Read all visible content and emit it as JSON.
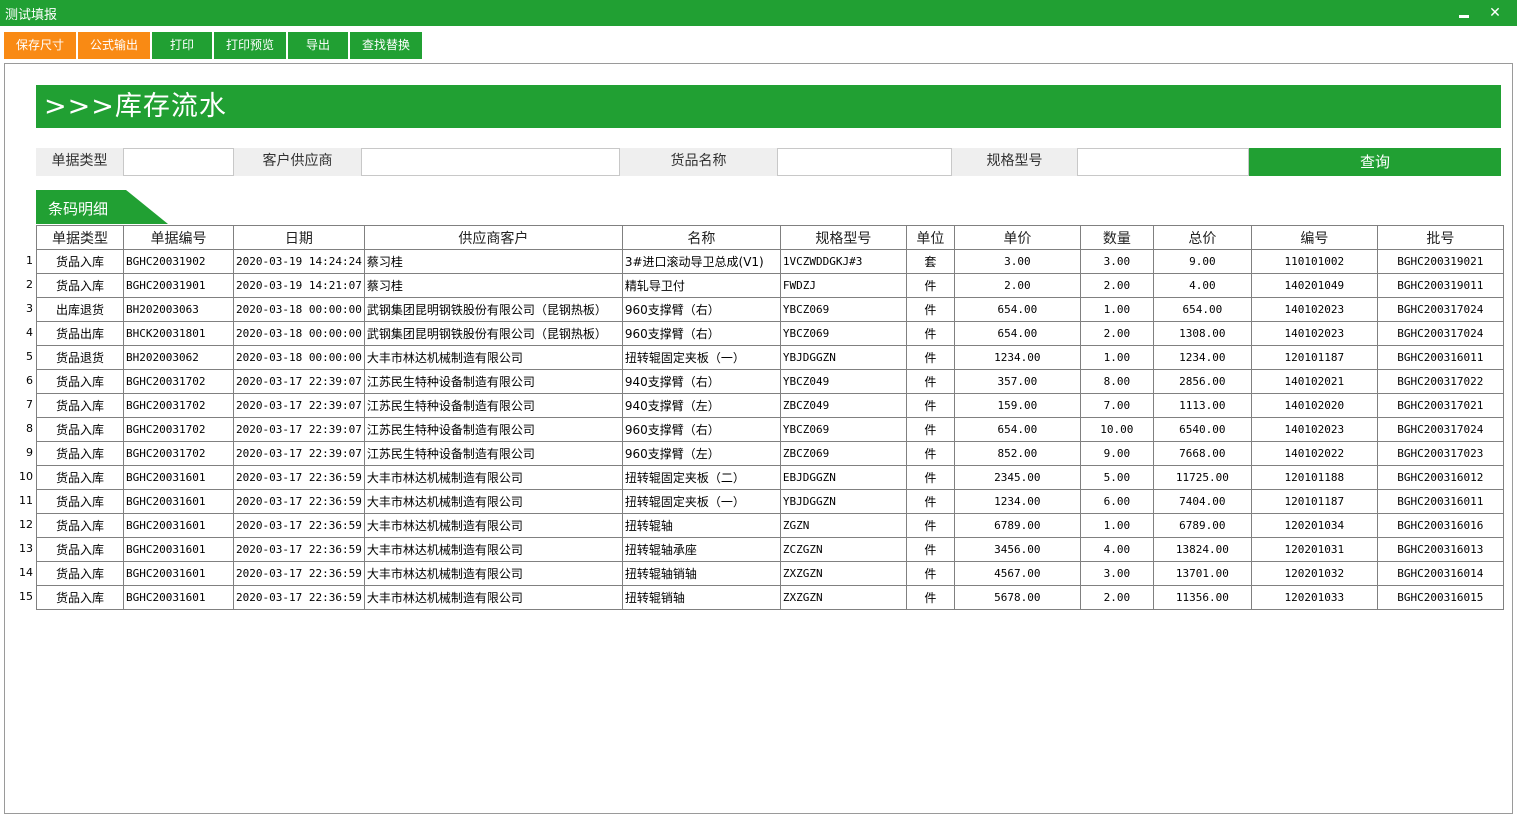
{
  "window": {
    "title": "测试填报",
    "minimize_label": "",
    "close_label": "✕"
  },
  "toolbar": [
    {
      "label": "保存尺寸",
      "color": "#f98a14"
    },
    {
      "label": "公式输出",
      "color": "#f98a14"
    },
    {
      "label": "打印",
      "color": "#21a033"
    },
    {
      "label": "打印预览",
      "color": "#21a033"
    },
    {
      "label": "导出",
      "color": "#21a033"
    },
    {
      "label": "查找替换",
      "color": "#21a033"
    }
  ],
  "banner": {
    "title": ">>>库存流水"
  },
  "filters": {
    "doc_type_label": "单据类型",
    "doc_type_value": "",
    "customer_label": "客户供应商",
    "customer_value": "",
    "goods_label": "货品名称",
    "goods_value": "",
    "spec_label": "规格型号",
    "spec_value": "",
    "query_label": "查询"
  },
  "section": {
    "title": "条码明细"
  },
  "table": {
    "columns": [
      "单据类型",
      "单据编号",
      "日期",
      "供应商客户",
      "名称",
      "规格型号",
      "单位",
      "单价",
      "数量",
      "总价",
      "编号",
      "批号"
    ],
    "rows": [
      {
        "n": "1",
        "type": "货品入库",
        "doc": "BGHC20031902",
        "date": "2020-03-19 14:24:24",
        "partner": "蔡习桂",
        "name": "3#进口滚动导卫总成(V1)",
        "spec": "1VCZWDDGKJ#3",
        "unit": "套",
        "price": "3.00",
        "qty": "3.00",
        "total": "9.00",
        "code": "110101002",
        "batch": "BGHC200319021"
      },
      {
        "n": "2",
        "type": "货品入库",
        "doc": "BGHC20031901",
        "date": "2020-03-19 14:21:07",
        "partner": "蔡习桂",
        "name": "精轧导卫付",
        "spec": "FWDZJ",
        "unit": "件",
        "price": "2.00",
        "qty": "2.00",
        "total": "4.00",
        "code": "140201049",
        "batch": "BGHC200319011"
      },
      {
        "n": "3",
        "type": "出库退货",
        "doc": "BH202003063",
        "date": "2020-03-18 00:00:00",
        "partner": "武钢集团昆明钢铁股份有限公司（昆钢热板）",
        "name": "960支撑臂（右）",
        "spec": "YBCZ069",
        "unit": "件",
        "price": "654.00",
        "qty": "1.00",
        "total": "654.00",
        "code": "140102023",
        "batch": "BGHC200317024"
      },
      {
        "n": "4",
        "type": "货品出库",
        "doc": "BHCK20031801",
        "date": "2020-03-18 00:00:00",
        "partner": "武钢集团昆明钢铁股份有限公司（昆钢热板）",
        "name": "960支撑臂（右）",
        "spec": "YBCZ069",
        "unit": "件",
        "price": "654.00",
        "qty": "2.00",
        "total": "1308.00",
        "code": "140102023",
        "batch": "BGHC200317024"
      },
      {
        "n": "5",
        "type": "货品退货",
        "doc": "BH202003062",
        "date": "2020-03-18 00:00:00",
        "partner": "大丰市林达机械制造有限公司",
        "name": "扭转辊固定夹板（一）",
        "spec": "YBJDGGZN",
        "unit": "件",
        "price": "1234.00",
        "qty": "1.00",
        "total": "1234.00",
        "code": "120101187",
        "batch": "BGHC200316011"
      },
      {
        "n": "6",
        "type": "货品入库",
        "doc": "BGHC20031702",
        "date": "2020-03-17 22:39:07",
        "partner": "江苏民生特种设备制造有限公司",
        "name": "940支撑臂（右）",
        "spec": "YBCZ049",
        "unit": "件",
        "price": "357.00",
        "qty": "8.00",
        "total": "2856.00",
        "code": "140102021",
        "batch": "BGHC200317022"
      },
      {
        "n": "7",
        "type": "货品入库",
        "doc": "BGHC20031702",
        "date": "2020-03-17 22:39:07",
        "partner": "江苏民生特种设备制造有限公司",
        "name": "940支撑臂（左）",
        "spec": "ZBCZ049",
        "unit": "件",
        "price": "159.00",
        "qty": "7.00",
        "total": "1113.00",
        "code": "140102020",
        "batch": "BGHC200317021"
      },
      {
        "n": "8",
        "type": "货品入库",
        "doc": "BGHC20031702",
        "date": "2020-03-17 22:39:07",
        "partner": "江苏民生特种设备制造有限公司",
        "name": "960支撑臂（右）",
        "spec": "YBCZ069",
        "unit": "件",
        "price": "654.00",
        "qty": "10.00",
        "total": "6540.00",
        "code": "140102023",
        "batch": "BGHC200317024"
      },
      {
        "n": "9",
        "type": "货品入库",
        "doc": "BGHC20031702",
        "date": "2020-03-17 22:39:07",
        "partner": "江苏民生特种设备制造有限公司",
        "name": "960支撑臂（左）",
        "spec": "ZBCZ069",
        "unit": "件",
        "price": "852.00",
        "qty": "9.00",
        "total": "7668.00",
        "code": "140102022",
        "batch": "BGHC200317023"
      },
      {
        "n": "10",
        "type": "货品入库",
        "doc": "BGHC20031601",
        "date": "2020-03-17 22:36:59",
        "partner": "大丰市林达机械制造有限公司",
        "name": "扭转辊固定夹板（二）",
        "spec": "EBJDGGZN",
        "unit": "件",
        "price": "2345.00",
        "qty": "5.00",
        "total": "11725.00",
        "code": "120101188",
        "batch": "BGHC200316012"
      },
      {
        "n": "11",
        "type": "货品入库",
        "doc": "BGHC20031601",
        "date": "2020-03-17 22:36:59",
        "partner": "大丰市林达机械制造有限公司",
        "name": "扭转辊固定夹板（一）",
        "spec": "YBJDGGZN",
        "unit": "件",
        "price": "1234.00",
        "qty": "6.00",
        "total": "7404.00",
        "code": "120101187",
        "batch": "BGHC200316011"
      },
      {
        "n": "12",
        "type": "货品入库",
        "doc": "BGHC20031601",
        "date": "2020-03-17 22:36:59",
        "partner": "大丰市林达机械制造有限公司",
        "name": "扭转辊轴",
        "spec": "ZGZN",
        "unit": "件",
        "price": "6789.00",
        "qty": "1.00",
        "total": "6789.00",
        "code": "120201034",
        "batch": "BGHC200316016"
      },
      {
        "n": "13",
        "type": "货品入库",
        "doc": "BGHC20031601",
        "date": "2020-03-17 22:36:59",
        "partner": "大丰市林达机械制造有限公司",
        "name": "扭转辊轴承座",
        "spec": "ZCZGZN",
        "unit": "件",
        "price": "3456.00",
        "qty": "4.00",
        "total": "13824.00",
        "code": "120201031",
        "batch": "BGHC200316013"
      },
      {
        "n": "14",
        "type": "货品入库",
        "doc": "BGHC20031601",
        "date": "2020-03-17 22:36:59",
        "partner": "大丰市林达机械制造有限公司",
        "name": "扭转辊轴销轴",
        "spec": "ZXZGZN",
        "unit": "件",
        "price": "4567.00",
        "qty": "3.00",
        "total": "13701.00",
        "code": "120201032",
        "batch": "BGHC200316014"
      },
      {
        "n": "15",
        "type": "货品入库",
        "doc": "BGHC20031601",
        "date": "2020-03-17 22:36:59",
        "partner": "大丰市林达机械制造有限公司",
        "name": "扭转辊销轴",
        "spec": "ZXZGZN",
        "unit": "件",
        "price": "5678.00",
        "qty": "2.00",
        "total": "11356.00",
        "code": "120201033",
        "batch": "BGHC200316015"
      }
    ]
  }
}
